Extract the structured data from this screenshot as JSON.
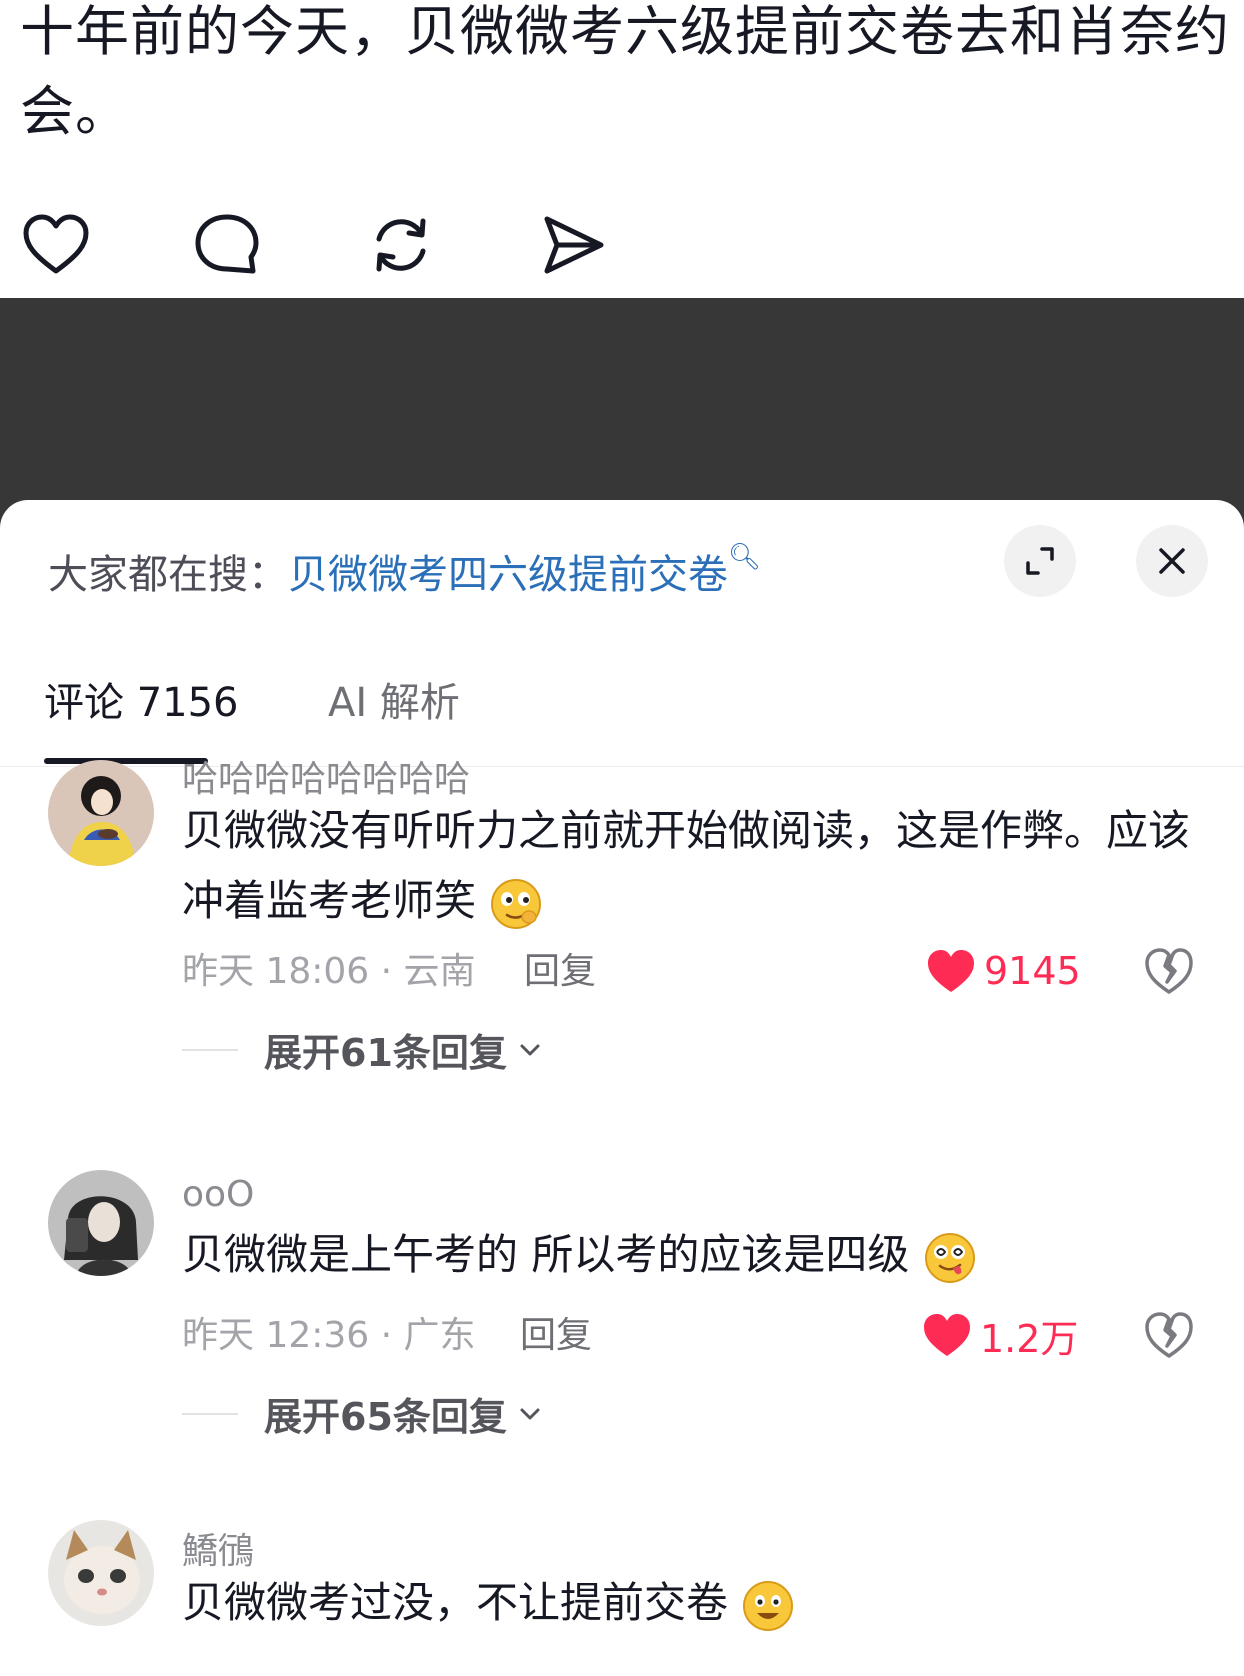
{
  "post": {
    "text": "十年前的今天，贝微微考六级提前交卷去和肖奈约会。",
    "actions": [
      "like-icon",
      "comment-icon",
      "repost-icon",
      "share-icon"
    ]
  },
  "sheet": {
    "search_prefix": "大家都在搜：",
    "search_keyword": "贝微微考四六级提前交卷",
    "tabs": [
      {
        "label": "评论 7156",
        "active": true
      },
      {
        "label": "AI 解析",
        "active": false
      }
    ]
  },
  "comments": [
    {
      "username": "哈哈哈哈哈哈哈哈",
      "text": "贝微微没有听听力之前就开始做阅读，这是作弊。应该冲着监考老师笑",
      "emoji": "smirk-emoji",
      "time_location": "昨天 18:06 · 云南",
      "reply_label": "回复",
      "likes": "9145",
      "expand_label": "展开61条回复"
    },
    {
      "username": "ooO",
      "text": "贝微微是上午考的 所以考的应该是四级",
      "emoji": "dizzy-tongue-emoji",
      "time_location": "昨天 12:36 · 广东",
      "reply_label": "回复",
      "likes": "1.2万",
      "expand_label": "展开65条回复"
    },
    {
      "username": "鱎鴴",
      "text": "贝微微考过没，不让提前交卷",
      "emoji": "grin-emoji"
    }
  ],
  "colors": {
    "accent_red": "#fe2c55",
    "link_blue": "#2a6fb8",
    "dark_band": "#373737"
  }
}
